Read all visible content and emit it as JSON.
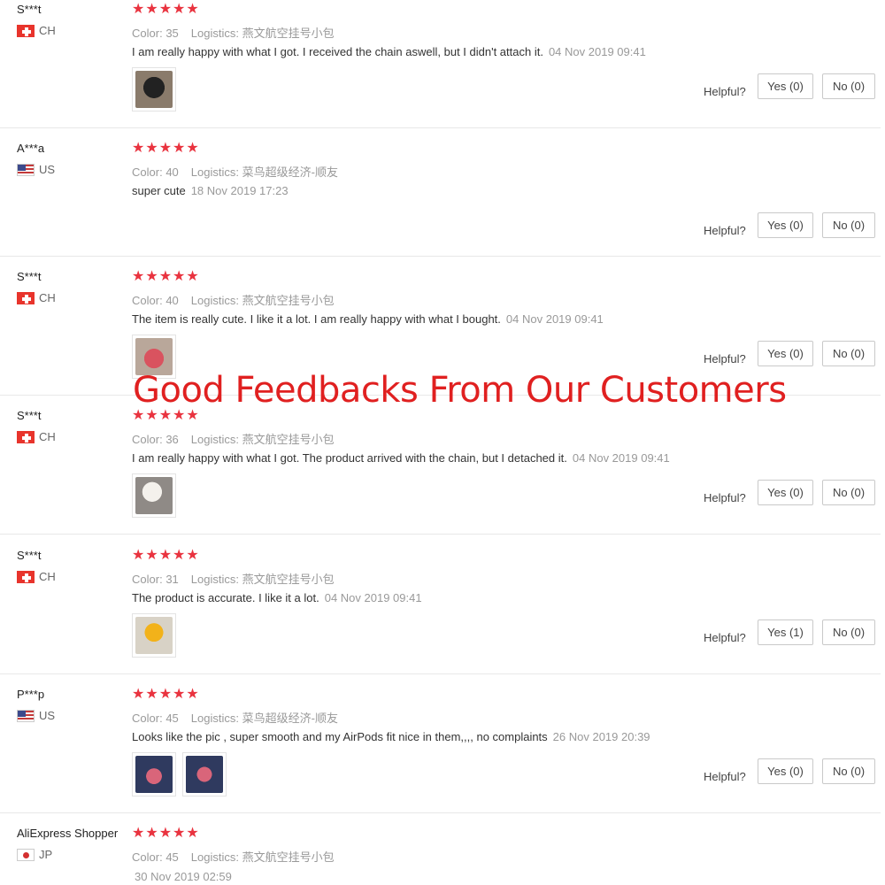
{
  "overlay_title": "Good Feedbacks From Our Customers",
  "colors": {
    "star": "#e9333f",
    "overlay": "#e02020",
    "muted": "#999999"
  },
  "helpful_label": "Helpful?",
  "color_label": "Color:",
  "logistics_label": "Logistics:",
  "reviews": [
    {
      "user": "S***t",
      "country": "CH",
      "rating": "★★★★★",
      "color_value": "35",
      "logistics_value": "燕文航空挂号小包",
      "text": "I am really happy with what I got. I received the chain aswell, but I didn't attach it.",
      "date": "04 Nov 2019 09:41",
      "yes": "Yes (0)",
      "no": "No (0)",
      "photos": [
        "photo-black-case"
      ]
    },
    {
      "user": "A***a",
      "country": "US",
      "rating": "★★★★★",
      "color_value": "40",
      "logistics_value": "菜鸟超级经济-顺友",
      "text": "super cute",
      "date": "18 Nov 2019 17:23",
      "yes": "Yes (0)",
      "no": "No (0)",
      "photos": []
    },
    {
      "user": "S***t",
      "country": "CH",
      "rating": "★★★★★",
      "color_value": "40",
      "logistics_value": "燕文航空挂号小包",
      "text": "The item is really cute. I like it a lot. I am really happy with what I bought.",
      "date": "04 Nov 2019 09:41",
      "yes": "Yes (0)",
      "no": "No (0)",
      "photos": [
        "photo-pink-case"
      ]
    },
    {
      "user": "S***t",
      "country": "CH",
      "rating": "★★★★★",
      "color_value": "36",
      "logistics_value": "燕文航空挂号小包",
      "text": "I am really happy with what I got. The product arrived with the chain, but I detached it.",
      "date": "04 Nov 2019 09:41",
      "yes": "Yes (0)",
      "no": "No (0)",
      "photos": [
        "photo-white-case"
      ]
    },
    {
      "user": "S***t",
      "country": "CH",
      "rating": "★★★★★",
      "color_value": "31",
      "logistics_value": "燕文航空挂号小包",
      "text": "The product is accurate. I like it a lot.",
      "date": "04 Nov 2019 09:41",
      "yes": "Yes (1)",
      "no": "No (0)",
      "photos": [
        "photo-yellow-case"
      ]
    },
    {
      "user": "P***p",
      "country": "US",
      "rating": "★★★★★",
      "color_value": "45",
      "logistics_value": "菜鸟超级经济-顺友",
      "text": "Looks like the pic , super smooth and my AirPods fit nice in them,,,, no complaints",
      "date": "26 Nov 2019 20:39",
      "yes": "Yes (0)",
      "no": "No (0)",
      "photos": [
        "photo-case-in-hand",
        "photo-case-in-hand-2"
      ]
    },
    {
      "user": "AliExpress Shopper",
      "country": "JP",
      "rating": "★★★★★",
      "color_value": "45",
      "logistics_value": "燕文航空挂号小包",
      "text": "",
      "date": "30 Nov 2019 02:59",
      "yes": "",
      "no": "",
      "photos": []
    }
  ]
}
